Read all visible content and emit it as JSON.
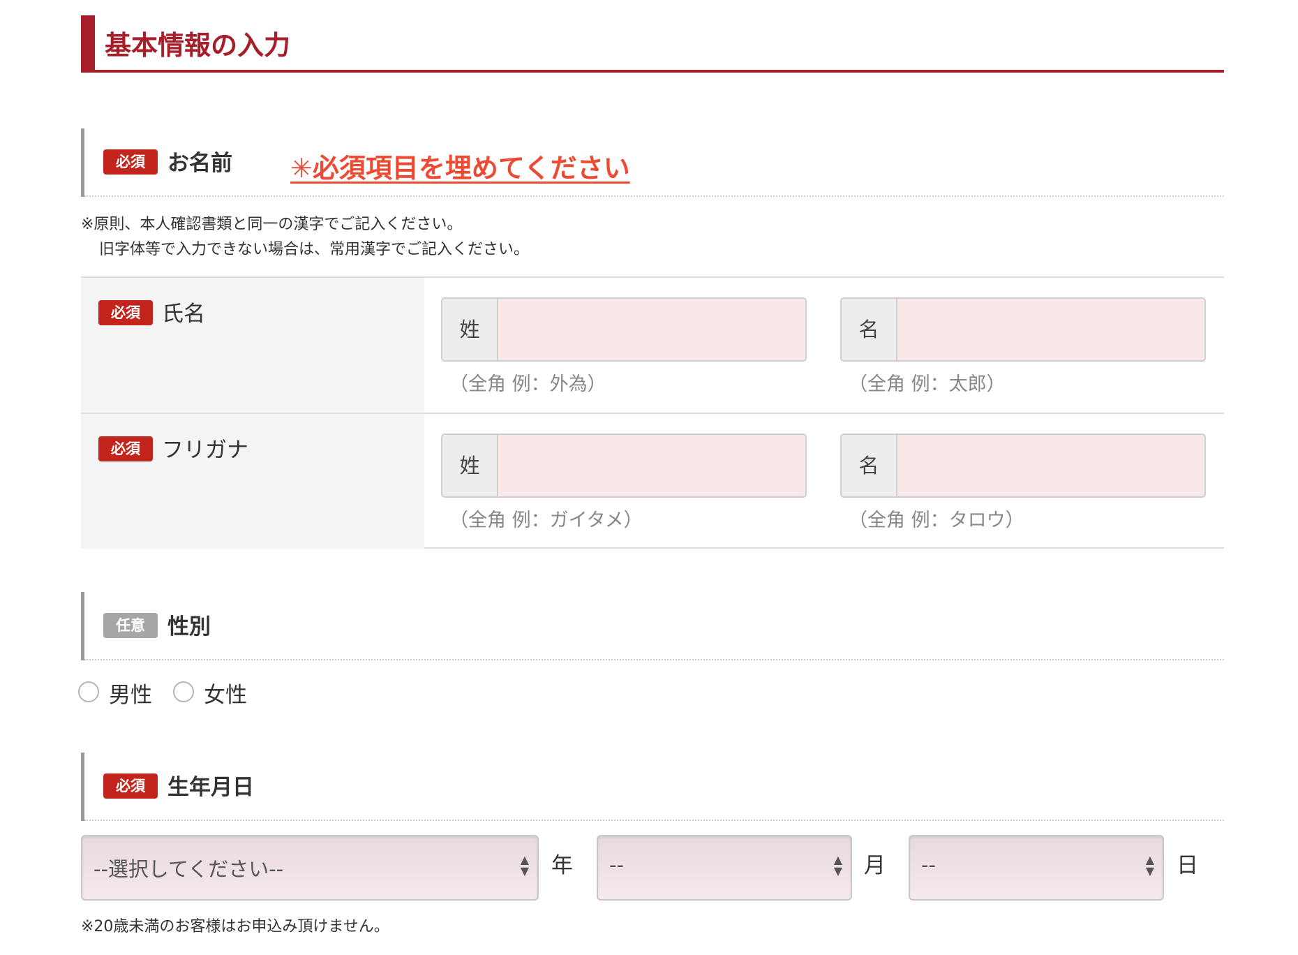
{
  "page_title": "基本情報の入力",
  "badges": {
    "required": "必須",
    "optional": "任意"
  },
  "name_section": {
    "title": "お名前",
    "notice": "✳必須項目を埋めてください",
    "note_line1": "※原則、本人確認書類と同一の漢字でご記入ください。",
    "note_line2": "旧字体等で入力できない場合は、常用漢字でご記入ください。",
    "rows": [
      {
        "label": "氏名",
        "sei_prefix": "姓",
        "sei_value": "",
        "sei_hint": "（全角 例：外為）",
        "mei_prefix": "名",
        "mei_value": "",
        "mei_hint": "（全角 例：太郎）"
      },
      {
        "label": "フリガナ",
        "sei_prefix": "姓",
        "sei_value": "",
        "sei_hint": "（全角 例：ガイタメ）",
        "mei_prefix": "名",
        "mei_value": "",
        "mei_hint": "（全角 例：タロウ）"
      }
    ]
  },
  "gender_section": {
    "title": "性別",
    "options": [
      "男性",
      "女性"
    ],
    "selected": null
  },
  "birth_section": {
    "title": "生年月日",
    "year_value": "--選択してください--",
    "year_unit": "年",
    "month_value": "--",
    "month_unit": "月",
    "day_value": "--",
    "day_unit": "日",
    "note": "※20歳未満のお客様はお申込み頂けません。"
  },
  "colors": {
    "accent": "#a61e2a",
    "required_badge": "#c3251d",
    "optional_badge": "#a6a6a6",
    "notice": "#ec4a32",
    "input_bg": "#f8e8ea"
  },
  "icons": {
    "select_arrows": "up-down-arrows-icon"
  }
}
